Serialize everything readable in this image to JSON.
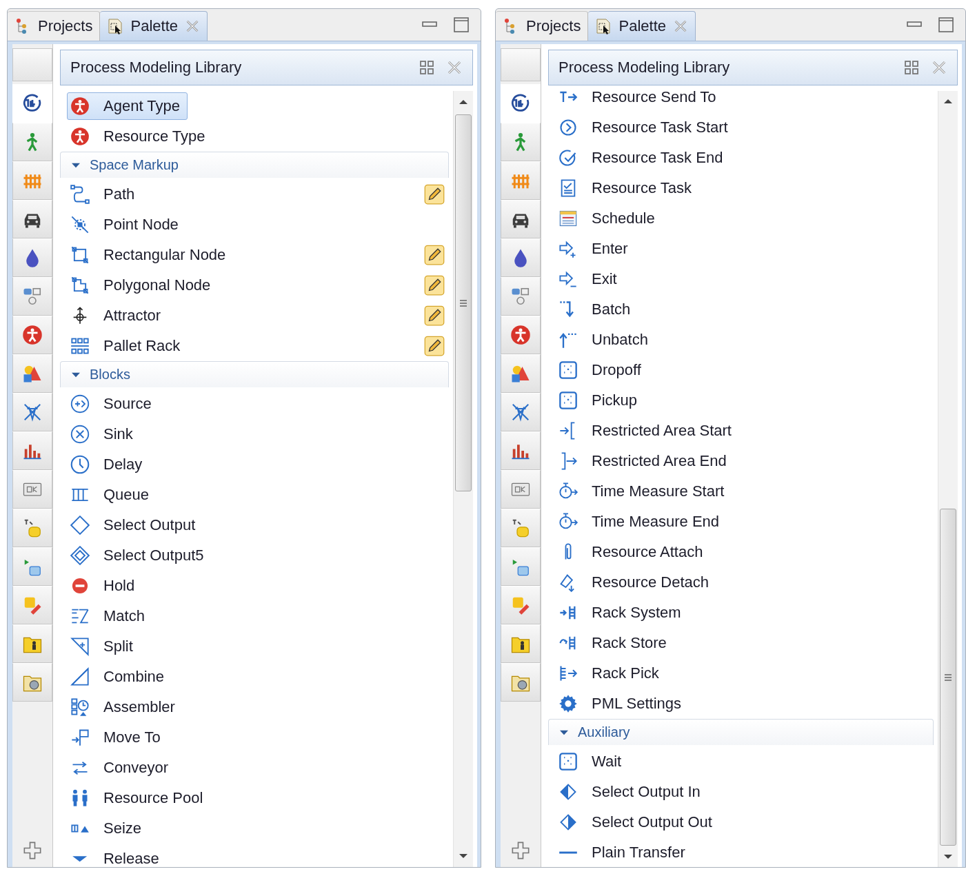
{
  "panels": [
    {
      "tabs": [
        {
          "label": "Projects",
          "selected": false
        },
        {
          "label": "Palette",
          "selected": true,
          "closable": true
        }
      ],
      "side_tabs": [
        {
          "selected": true
        },
        {
          "selected": false
        },
        {
          "selected": false
        },
        {
          "selected": false
        },
        {
          "selected": false
        },
        {
          "selected": false
        },
        {
          "selected": false
        },
        {
          "selected": false
        },
        {
          "selected": false
        },
        {
          "selected": false
        },
        {
          "selected": false
        },
        {
          "selected": false
        },
        {
          "selected": false
        },
        {
          "selected": false
        },
        {
          "selected": false
        },
        {
          "selected": false
        }
      ],
      "library": {
        "title": "Process Modeling Library"
      },
      "entries": [
        {
          "kind": "item",
          "label": "Agent Type",
          "selected": true
        },
        {
          "kind": "item",
          "label": "Resource Type",
          "selected": false
        },
        {
          "kind": "section",
          "label": "Space Markup",
          "expanded": true,
          "children": [
            {
              "label": "Path",
              "selected": false,
              "drawable": true
            },
            {
              "label": "Point Node",
              "selected": false,
              "drawable": false
            },
            {
              "label": "Rectangular Node",
              "selected": false,
              "drawable": true
            },
            {
              "label": "Polygonal Node",
              "selected": false,
              "drawable": true
            },
            {
              "label": "Attractor",
              "selected": false,
              "drawable": true
            },
            {
              "label": "Pallet Rack",
              "selected": false,
              "drawable": true
            }
          ]
        },
        {
          "kind": "section",
          "label": "Blocks",
          "expanded": true,
          "children": [
            {
              "label": "Source",
              "selected": false
            },
            {
              "label": "Sink",
              "selected": false
            },
            {
              "label": "Delay",
              "selected": false
            },
            {
              "label": "Queue",
              "selected": false
            },
            {
              "label": "Select Output",
              "selected": false
            },
            {
              "label": "Select Output5",
              "selected": false
            },
            {
              "label": "Hold",
              "selected": false
            },
            {
              "label": "Match",
              "selected": false
            },
            {
              "label": "Split",
              "selected": false
            },
            {
              "label": "Combine",
              "selected": false
            },
            {
              "label": "Assembler",
              "selected": false
            },
            {
              "label": "Move To",
              "selected": false
            },
            {
              "label": "Conveyor",
              "selected": false
            },
            {
              "label": "Resource Pool",
              "selected": false
            },
            {
              "label": "Seize",
              "selected": false
            },
            {
              "label": "Release",
              "selected": false
            }
          ]
        }
      ]
    },
    {
      "tabs": [
        {
          "label": "Projects",
          "selected": false
        },
        {
          "label": "Palette",
          "selected": true,
          "closable": true
        }
      ],
      "side_tabs": [
        {
          "selected": true
        },
        {
          "selected": false
        },
        {
          "selected": false
        },
        {
          "selected": false
        },
        {
          "selected": false
        },
        {
          "selected": false
        },
        {
          "selected": false
        },
        {
          "selected": false
        },
        {
          "selected": false
        },
        {
          "selected": false
        },
        {
          "selected": false
        },
        {
          "selected": false
        },
        {
          "selected": false
        },
        {
          "selected": false
        },
        {
          "selected": false
        },
        {
          "selected": false
        }
      ],
      "library": {
        "title": "Process Modeling Library"
      },
      "entries": [
        {
          "kind": "item",
          "label": "Resource Send To",
          "selected": false
        },
        {
          "kind": "item",
          "label": "Resource Task Start",
          "selected": false
        },
        {
          "kind": "item",
          "label": "Resource Task End",
          "selected": false
        },
        {
          "kind": "item",
          "label": "Resource Task",
          "selected": false
        },
        {
          "kind": "item",
          "label": "Schedule",
          "selected": false
        },
        {
          "kind": "item",
          "label": "Enter",
          "selected": false
        },
        {
          "kind": "item",
          "label": "Exit",
          "selected": false
        },
        {
          "kind": "item",
          "label": "Batch",
          "selected": false
        },
        {
          "kind": "item",
          "label": "Unbatch",
          "selected": false
        },
        {
          "kind": "item",
          "label": "Dropoff",
          "selected": false
        },
        {
          "kind": "item",
          "label": "Pickup",
          "selected": false
        },
        {
          "kind": "item",
          "label": "Restricted Area Start",
          "selected": false
        },
        {
          "kind": "item",
          "label": "Restricted Area End",
          "selected": false
        },
        {
          "kind": "item",
          "label": "Time Measure Start",
          "selected": false
        },
        {
          "kind": "item",
          "label": "Time Measure End",
          "selected": false
        },
        {
          "kind": "item",
          "label": "Resource Attach",
          "selected": false
        },
        {
          "kind": "item",
          "label": "Resource Detach",
          "selected": false
        },
        {
          "kind": "item",
          "label": "Rack System",
          "selected": false
        },
        {
          "kind": "item",
          "label": "Rack Store",
          "selected": false
        },
        {
          "kind": "item",
          "label": "Rack Pick",
          "selected": false
        },
        {
          "kind": "item",
          "label": "PML Settings",
          "selected": false
        },
        {
          "kind": "section",
          "label": "Auxiliary",
          "expanded": true,
          "children": [
            {
              "label": "Wait",
              "selected": false
            },
            {
              "label": "Select Output In",
              "selected": false
            },
            {
              "label": "Select Output Out",
              "selected": false
            },
            {
              "label": "Plain Transfer",
              "selected": false
            }
          ]
        }
      ]
    }
  ]
}
